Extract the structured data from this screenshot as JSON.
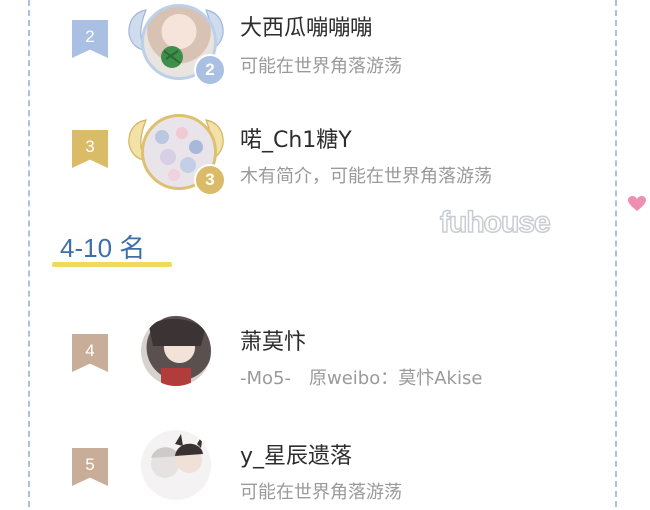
{
  "section": {
    "title": "4-10 名"
  },
  "watermark": {
    "text": "fuhouse"
  },
  "colors": {
    "blue_rank": "#a9c0e3",
    "gold_rank": "#d9bb68",
    "bronze_rank": "#c8ad99",
    "dash_border": "#a9c3de",
    "section_title": "#3f6fa8",
    "underline": "#f2d95c"
  },
  "entries": [
    {
      "rank": "2",
      "medal": "2",
      "name": "大西瓜嘣嘣嘣",
      "bio": "可能在世界角落游荡"
    },
    {
      "rank": "3",
      "medal": "3",
      "name": "喏_Ch1糖Y",
      "bio": "木有简介，可能在世界角落游荡"
    },
    {
      "rank": "4",
      "name": "萧莫忭",
      "bio": "-Mo5-　原weibo：莫忭Akise"
    },
    {
      "rank": "5",
      "name": "y_星辰遗落",
      "bio": "可能在世界角落游荡"
    }
  ]
}
